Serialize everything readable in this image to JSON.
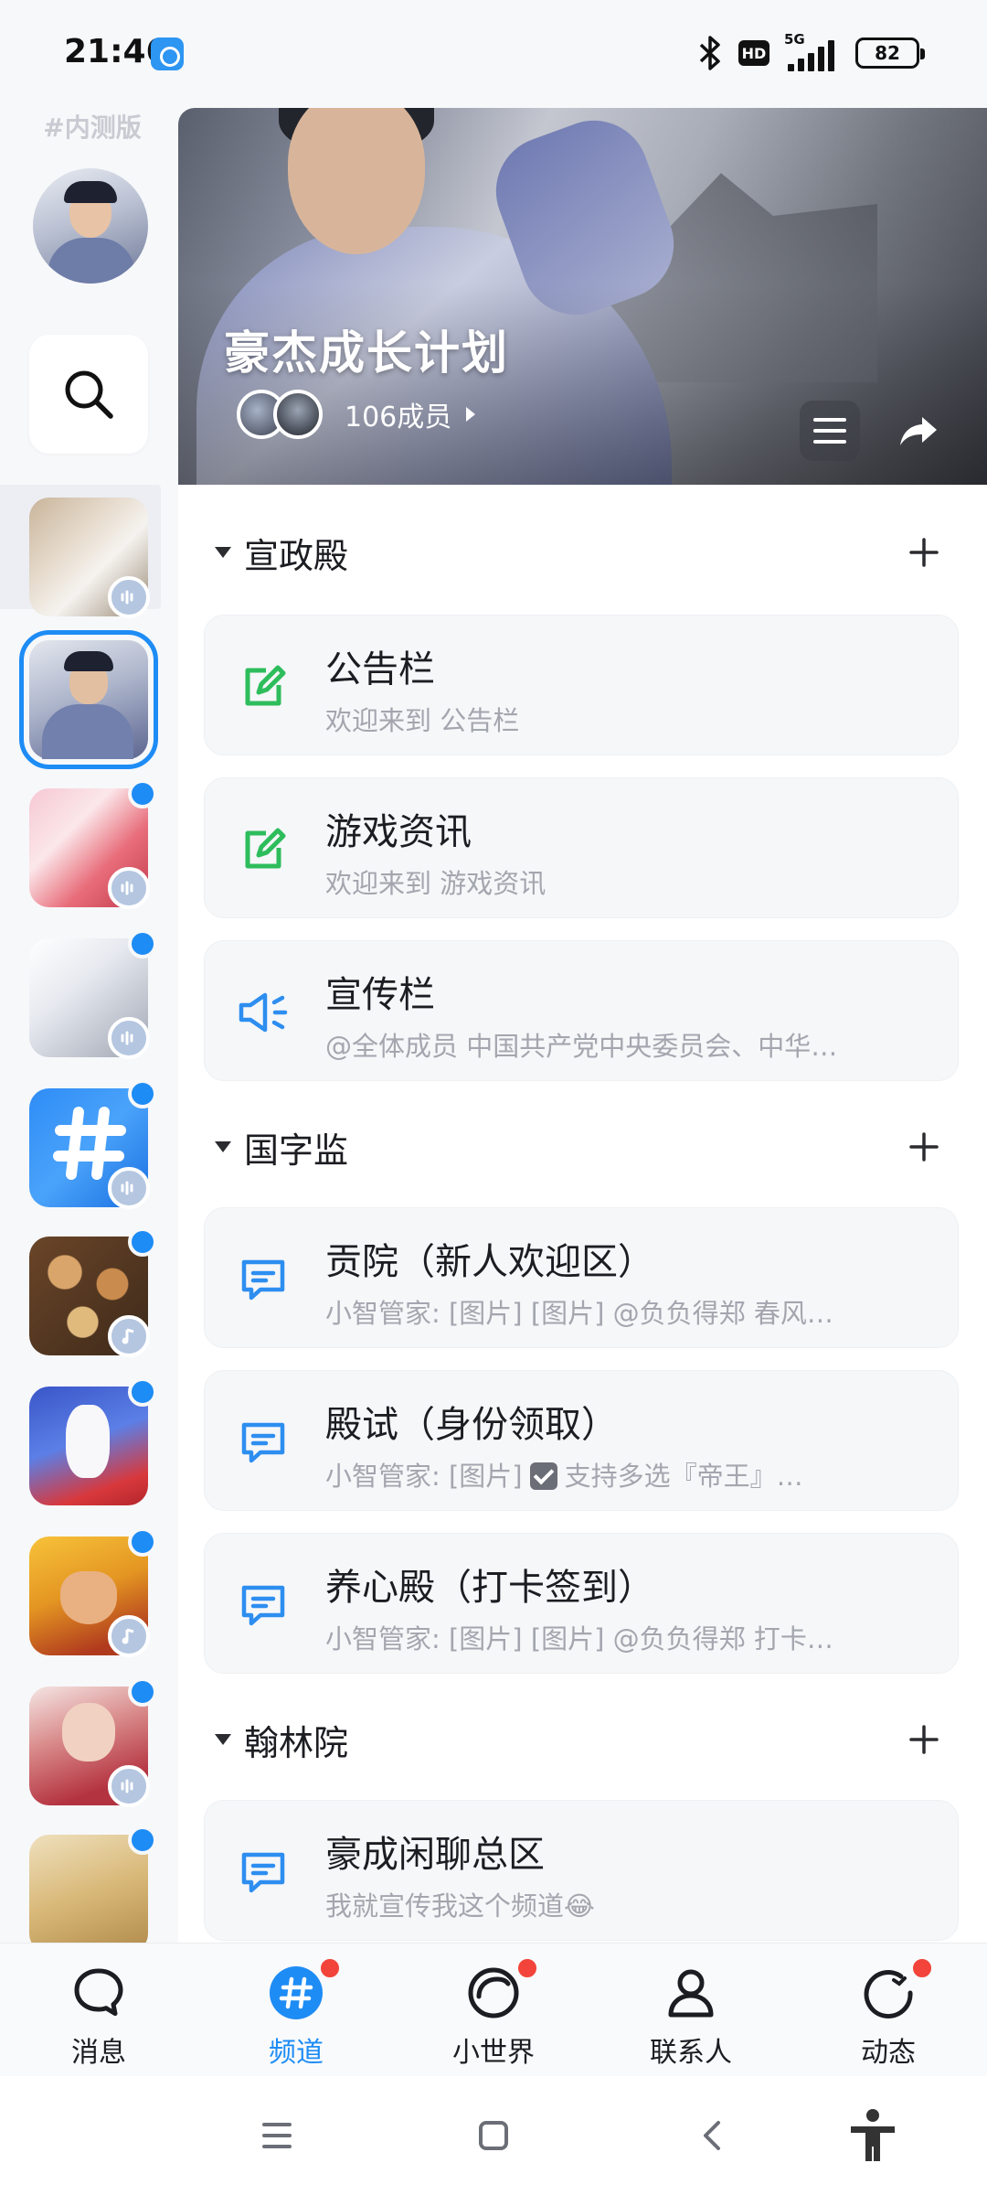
{
  "status_bar": {
    "time": "21:46",
    "hd": "HD",
    "network": "5G",
    "battery": "82"
  },
  "rail": {
    "beta_tag": "#内测版",
    "guild_icons": [
      "dog-photo",
      "scholar-guild",
      "anime-girl-cat",
      "grey-cat-boy",
      "channel-hash",
      "food-table",
      "rabbit-shanghai",
      "clash-clans",
      "red-dress-girl",
      "golden-beauty"
    ]
  },
  "guild": {
    "name": "豪杰成长计划",
    "member_count": "106成员"
  },
  "categories": [
    {
      "name": "宣政殿",
      "channels": [
        {
          "name": "公告栏",
          "sub": "欢迎来到 公告栏",
          "icon": "post-icon"
        },
        {
          "name": "游戏资讯",
          "sub": "欢迎来到 游戏资讯",
          "icon": "post-icon"
        },
        {
          "name": "宣传栏",
          "sub": "@全体成员 中国共产党中央委员会、中华…",
          "icon": "broadcast-icon"
        }
      ]
    },
    {
      "name": "国字监",
      "channels": [
        {
          "name": "贡院（新人欢迎区）",
          "sub": "小智管家: [图片] [图片] @负负得郑 春风…",
          "icon": "chat-icon"
        },
        {
          "name": "殿试（身份领取）",
          "sub_prefix": "小智管家: [图片]",
          "sub_suffix": "支持多选『帝王』…",
          "icon": "chat-icon"
        },
        {
          "name": "养心殿（打卡签到）",
          "sub": "小智管家: [图片] [图片] @负负得郑 打卡…",
          "icon": "chat-icon"
        }
      ]
    },
    {
      "name": "翰林院",
      "channels": [
        {
          "name": "豪成闲聊总区",
          "sub": "我就宣传我这个频道😂",
          "icon": "chat-icon"
        }
      ]
    }
  ],
  "bottom_nav": [
    {
      "label": "消息",
      "icon": "message-icon"
    },
    {
      "label": "频道",
      "icon": "channel-icon"
    },
    {
      "label": "小世界",
      "icon": "world-icon"
    },
    {
      "label": "联系人",
      "icon": "contacts-icon"
    },
    {
      "label": "动态",
      "icon": "activity-icon"
    }
  ],
  "colors": {
    "accent": "#1e8cf5",
    "post_green": "#2ebd5c",
    "chat_blue": "#2d8ef0",
    "red_dot": "#f2443a"
  }
}
